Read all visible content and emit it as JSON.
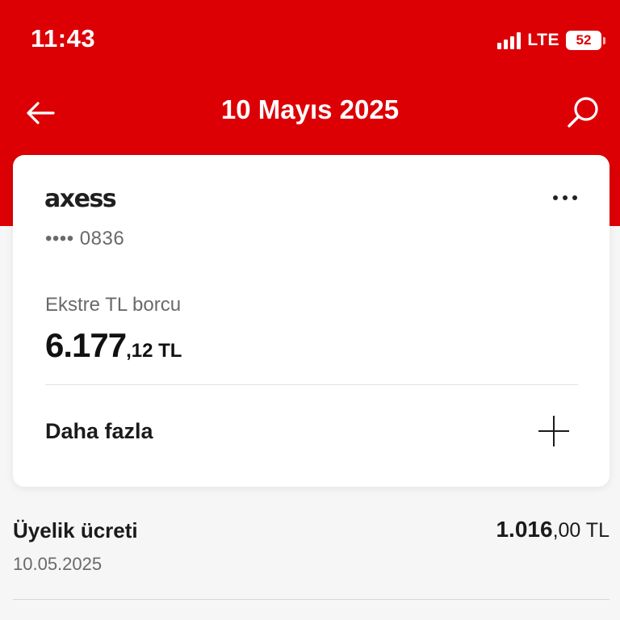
{
  "status_bar": {
    "time": "11:43",
    "network": "LTE",
    "battery": "52"
  },
  "header": {
    "title": "10 Mayıs 2025",
    "back_icon": "arrow-left-icon",
    "search_icon": "search-icon",
    "background_color": "#dc0005"
  },
  "card": {
    "brand": "axess",
    "masked_number": "•••• 0836",
    "more_icon": "more-horizontal-icon",
    "debt_label": "Ekstre TL borcu",
    "debt_integer": "6.177",
    "debt_decimal": ",12 TL",
    "expand_label": "Daha fazla",
    "expand_icon": "plus-icon"
  },
  "transactions": [
    {
      "title": "Üyelik ücreti",
      "date": "10.05.2025",
      "amount_integer": "1.016",
      "amount_decimal": ",00 TL"
    }
  ]
}
